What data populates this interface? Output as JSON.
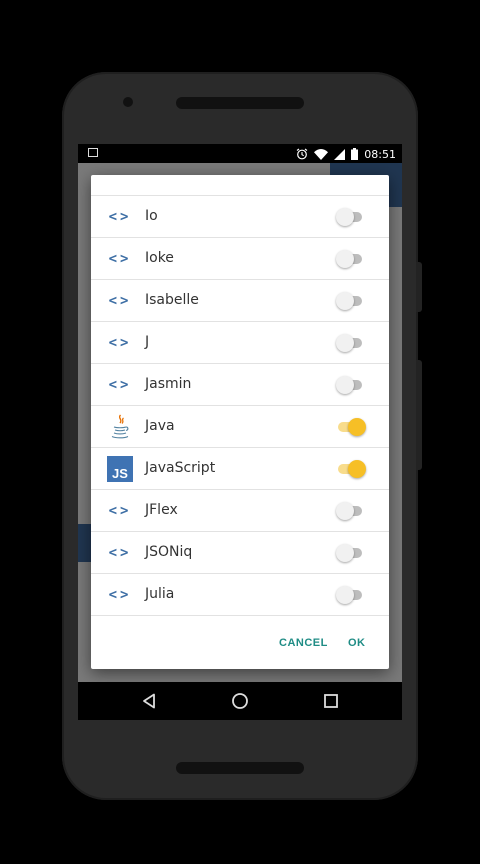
{
  "status_bar": {
    "time": "08:51",
    "left_icons": [
      "image-notification-icon"
    ],
    "right_icons": [
      "alarm-icon",
      "wifi-icon",
      "signal-icon",
      "battery-icon"
    ]
  },
  "dialog": {
    "items": [
      {
        "label": "Io",
        "icon": "code-icon",
        "enabled": false
      },
      {
        "label": "Ioke",
        "icon": "code-icon",
        "enabled": false
      },
      {
        "label": "Isabelle",
        "icon": "code-icon",
        "enabled": false
      },
      {
        "label": "J",
        "icon": "code-icon",
        "enabled": false
      },
      {
        "label": "Jasmin",
        "icon": "code-icon",
        "enabled": false
      },
      {
        "label": "Java",
        "icon": "java-icon",
        "enabled": true
      },
      {
        "label": "JavaScript",
        "icon": "javascript-icon",
        "enabled": true
      },
      {
        "label": "JFlex",
        "icon": "code-icon",
        "enabled": false
      },
      {
        "label": "JSONiq",
        "icon": "code-icon",
        "enabled": false
      },
      {
        "label": "Julia",
        "icon": "code-icon",
        "enabled": false
      }
    ],
    "cancel_label": "CANCEL",
    "ok_label": "OK",
    "js_badge_text": "JS"
  },
  "colors": {
    "accent": "#1f8c85",
    "toggle_on": "#f6bf26",
    "code_icon": "#3e6fa5"
  },
  "nav_bar": {
    "icons": [
      "back-icon",
      "home-icon",
      "recents-icon"
    ]
  }
}
